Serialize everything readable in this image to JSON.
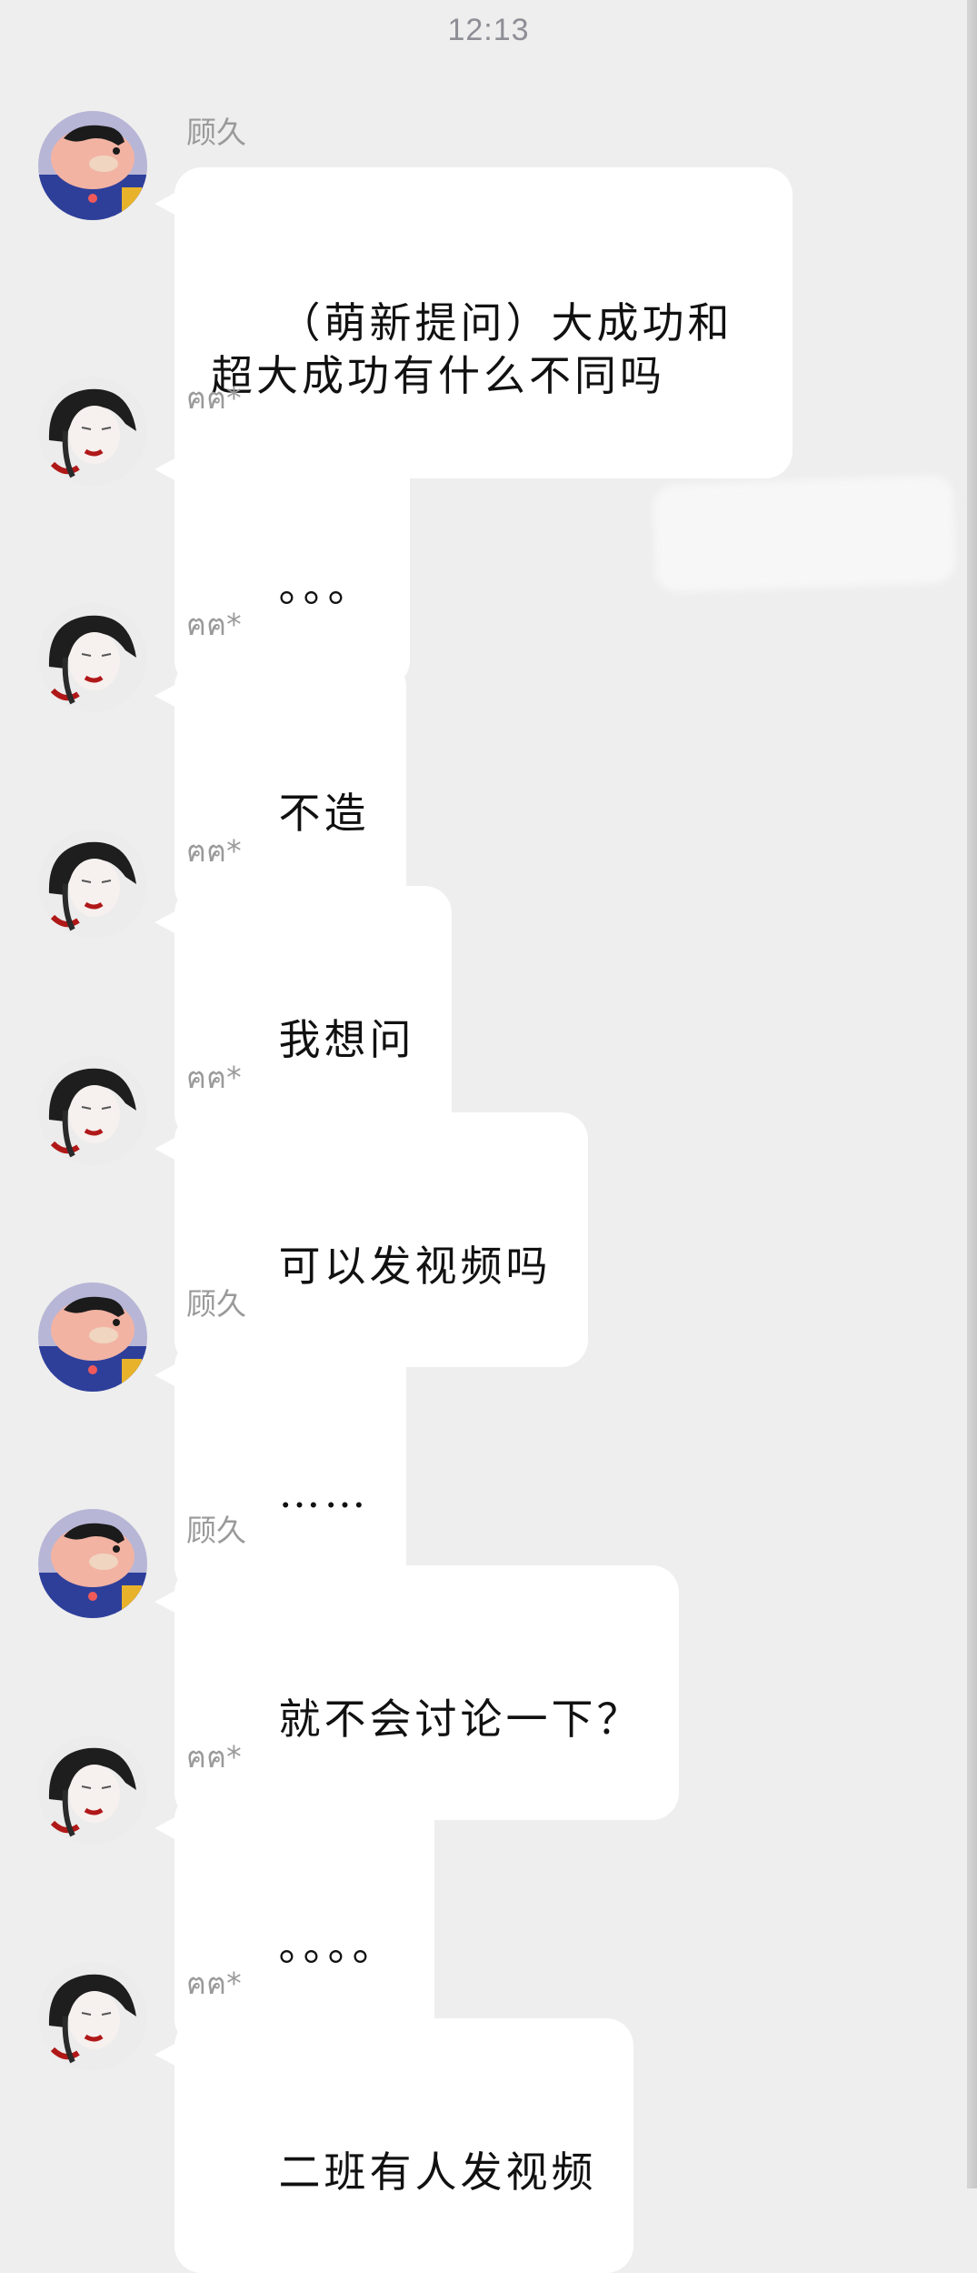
{
  "status": {
    "time": "12:13"
  },
  "users": {
    "gujiu": {
      "name": "顾久",
      "avatar_icon": "cartoon-boy-avatar-icon"
    },
    "other": {
      "name": "ฅฅ*",
      "avatar_icon": "dark-hair-portrait-avatar-icon"
    }
  },
  "messages": [
    {
      "sender": "顾久",
      "text": "（萌新提问）大成功和超大成功有什么不同吗"
    },
    {
      "sender": "ฅฅ*",
      "text": "。。。"
    },
    {
      "sender": "ฅฅ*",
      "text": "不造"
    },
    {
      "sender": "ฅฅ*",
      "text": "我想问"
    },
    {
      "sender": "ฅฅ*",
      "text": "可以发视频吗"
    },
    {
      "sender": "顾久",
      "text": "……"
    },
    {
      "sender": "顾久",
      "text": "就不会讨论一下？"
    },
    {
      "sender": "ฅฅ*",
      "text": "。。。。"
    },
    {
      "sender": "ฅฅ*",
      "text": "二班有人发视频"
    }
  ]
}
